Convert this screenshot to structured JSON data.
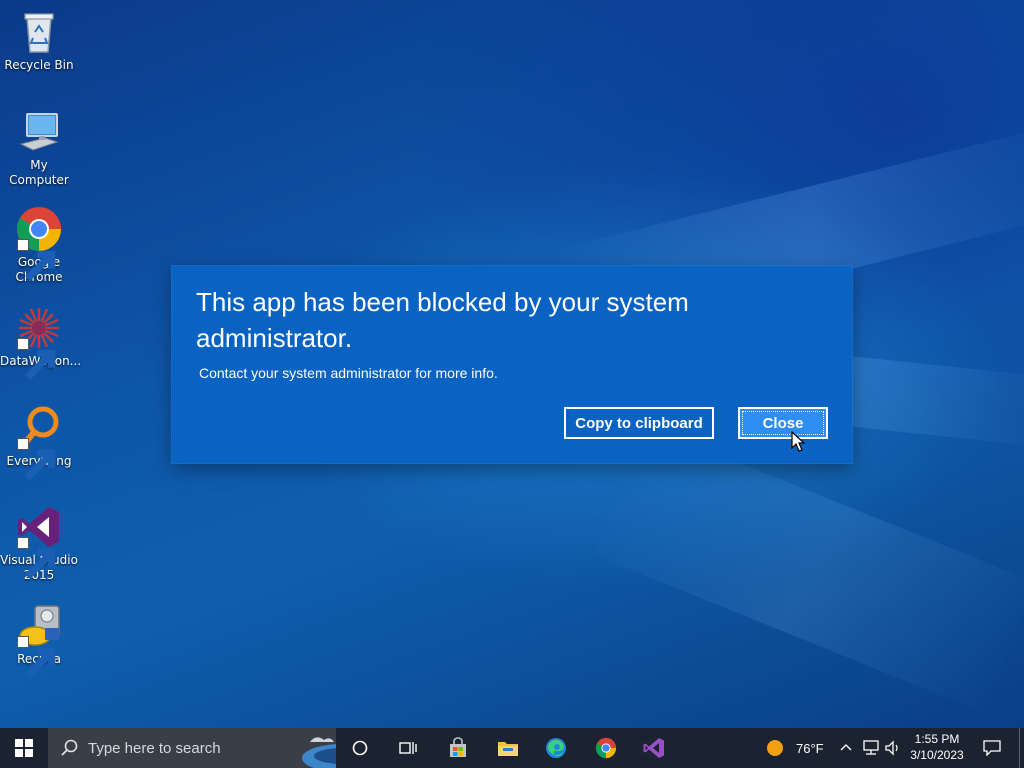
{
  "desktop": {
    "icons": [
      {
        "label": "Recycle Bin",
        "icon": "recycle-bin-icon"
      },
      {
        "label": "My Computer",
        "icon": "computer-icon"
      },
      {
        "label": "Google Chrome",
        "icon": "chrome-icon"
      },
      {
        "label": "DataWagon...",
        "icon": "datawagon-icon"
      },
      {
        "label": "Everything",
        "icon": "everything-search-icon"
      },
      {
        "label": "Visual Studio 2015",
        "icon": "visual-studio-icon"
      },
      {
        "label": "Recuva",
        "icon": "recuva-icon"
      }
    ]
  },
  "dialog": {
    "title": "This app has been blocked by your system administrator.",
    "message": "Contact your system administrator for more info.",
    "copy_label": "Copy to clipboard",
    "close_label": "Close",
    "background": "#0a63c2",
    "accent": "#2d8df0"
  },
  "taskbar": {
    "search_placeholder": "Type here to search",
    "pinned": [
      "start-button",
      "cortana-button",
      "task-view-button",
      "microsoft-store",
      "file-explorer",
      "microsoft-edge",
      "google-chrome",
      "visual-studio"
    ],
    "weather": {
      "temperature": "76°F",
      "icon": "sun-icon"
    },
    "clock": {
      "time": "1:55 PM",
      "date": "3/10/2023"
    }
  }
}
